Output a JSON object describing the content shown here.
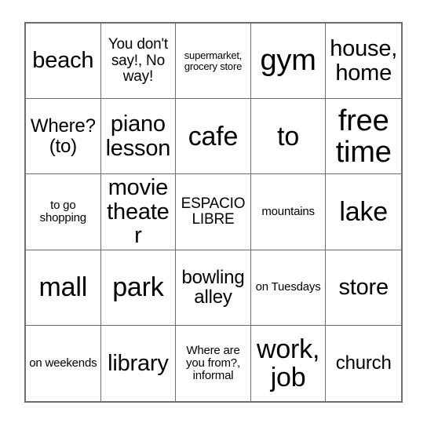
{
  "card": {
    "type": "bingo-card",
    "rows": 5,
    "columns": 5,
    "free_space_label": "ESPACIO LIBRE",
    "border_color": "#6d6d6d",
    "background_color": "#ffffff",
    "text_color": "#000000",
    "cells": [
      {
        "text": "beach",
        "size": "fs-md"
      },
      {
        "text": "You don't say!, No way!",
        "size": "fs-xs"
      },
      {
        "text": "supermarket, grocery store",
        "size": "fs-tiny"
      },
      {
        "text": "gym",
        "size": "fs-xl"
      },
      {
        "text": "house, home",
        "size": "fs-md"
      },
      {
        "text": "Where? (to)",
        "size": "fs-sm"
      },
      {
        "text": "piano lesson",
        "size": "fs-md"
      },
      {
        "text": "cafe",
        "size": "fs-lg"
      },
      {
        "text": "to",
        "size": "fs-lg"
      },
      {
        "text": "free time",
        "size": "fs-xl"
      },
      {
        "text": "to go shopping",
        "size": "fs-xxs"
      },
      {
        "text": "movie theater",
        "size": "fs-md"
      },
      {
        "text": "ESPACIO LIBRE",
        "size": "fs-xs"
      },
      {
        "text": "mountains",
        "size": "fs-xxs"
      },
      {
        "text": "lake",
        "size": "fs-lg"
      },
      {
        "text": "mall",
        "size": "fs-lg"
      },
      {
        "text": "park",
        "size": "fs-lg"
      },
      {
        "text": "bowling alley",
        "size": "fs-sm"
      },
      {
        "text": "on Tuesdays",
        "size": "fs-xxs"
      },
      {
        "text": "store",
        "size": "fs-md"
      },
      {
        "text": "on weekends",
        "size": "fs-xxs"
      },
      {
        "text": "library",
        "size": "fs-md"
      },
      {
        "text": "Where are you from?, informal",
        "size": "fs-xxs"
      },
      {
        "text": "work, job",
        "size": "fs-lg"
      },
      {
        "text": "church",
        "size": "fs-sm"
      }
    ]
  }
}
